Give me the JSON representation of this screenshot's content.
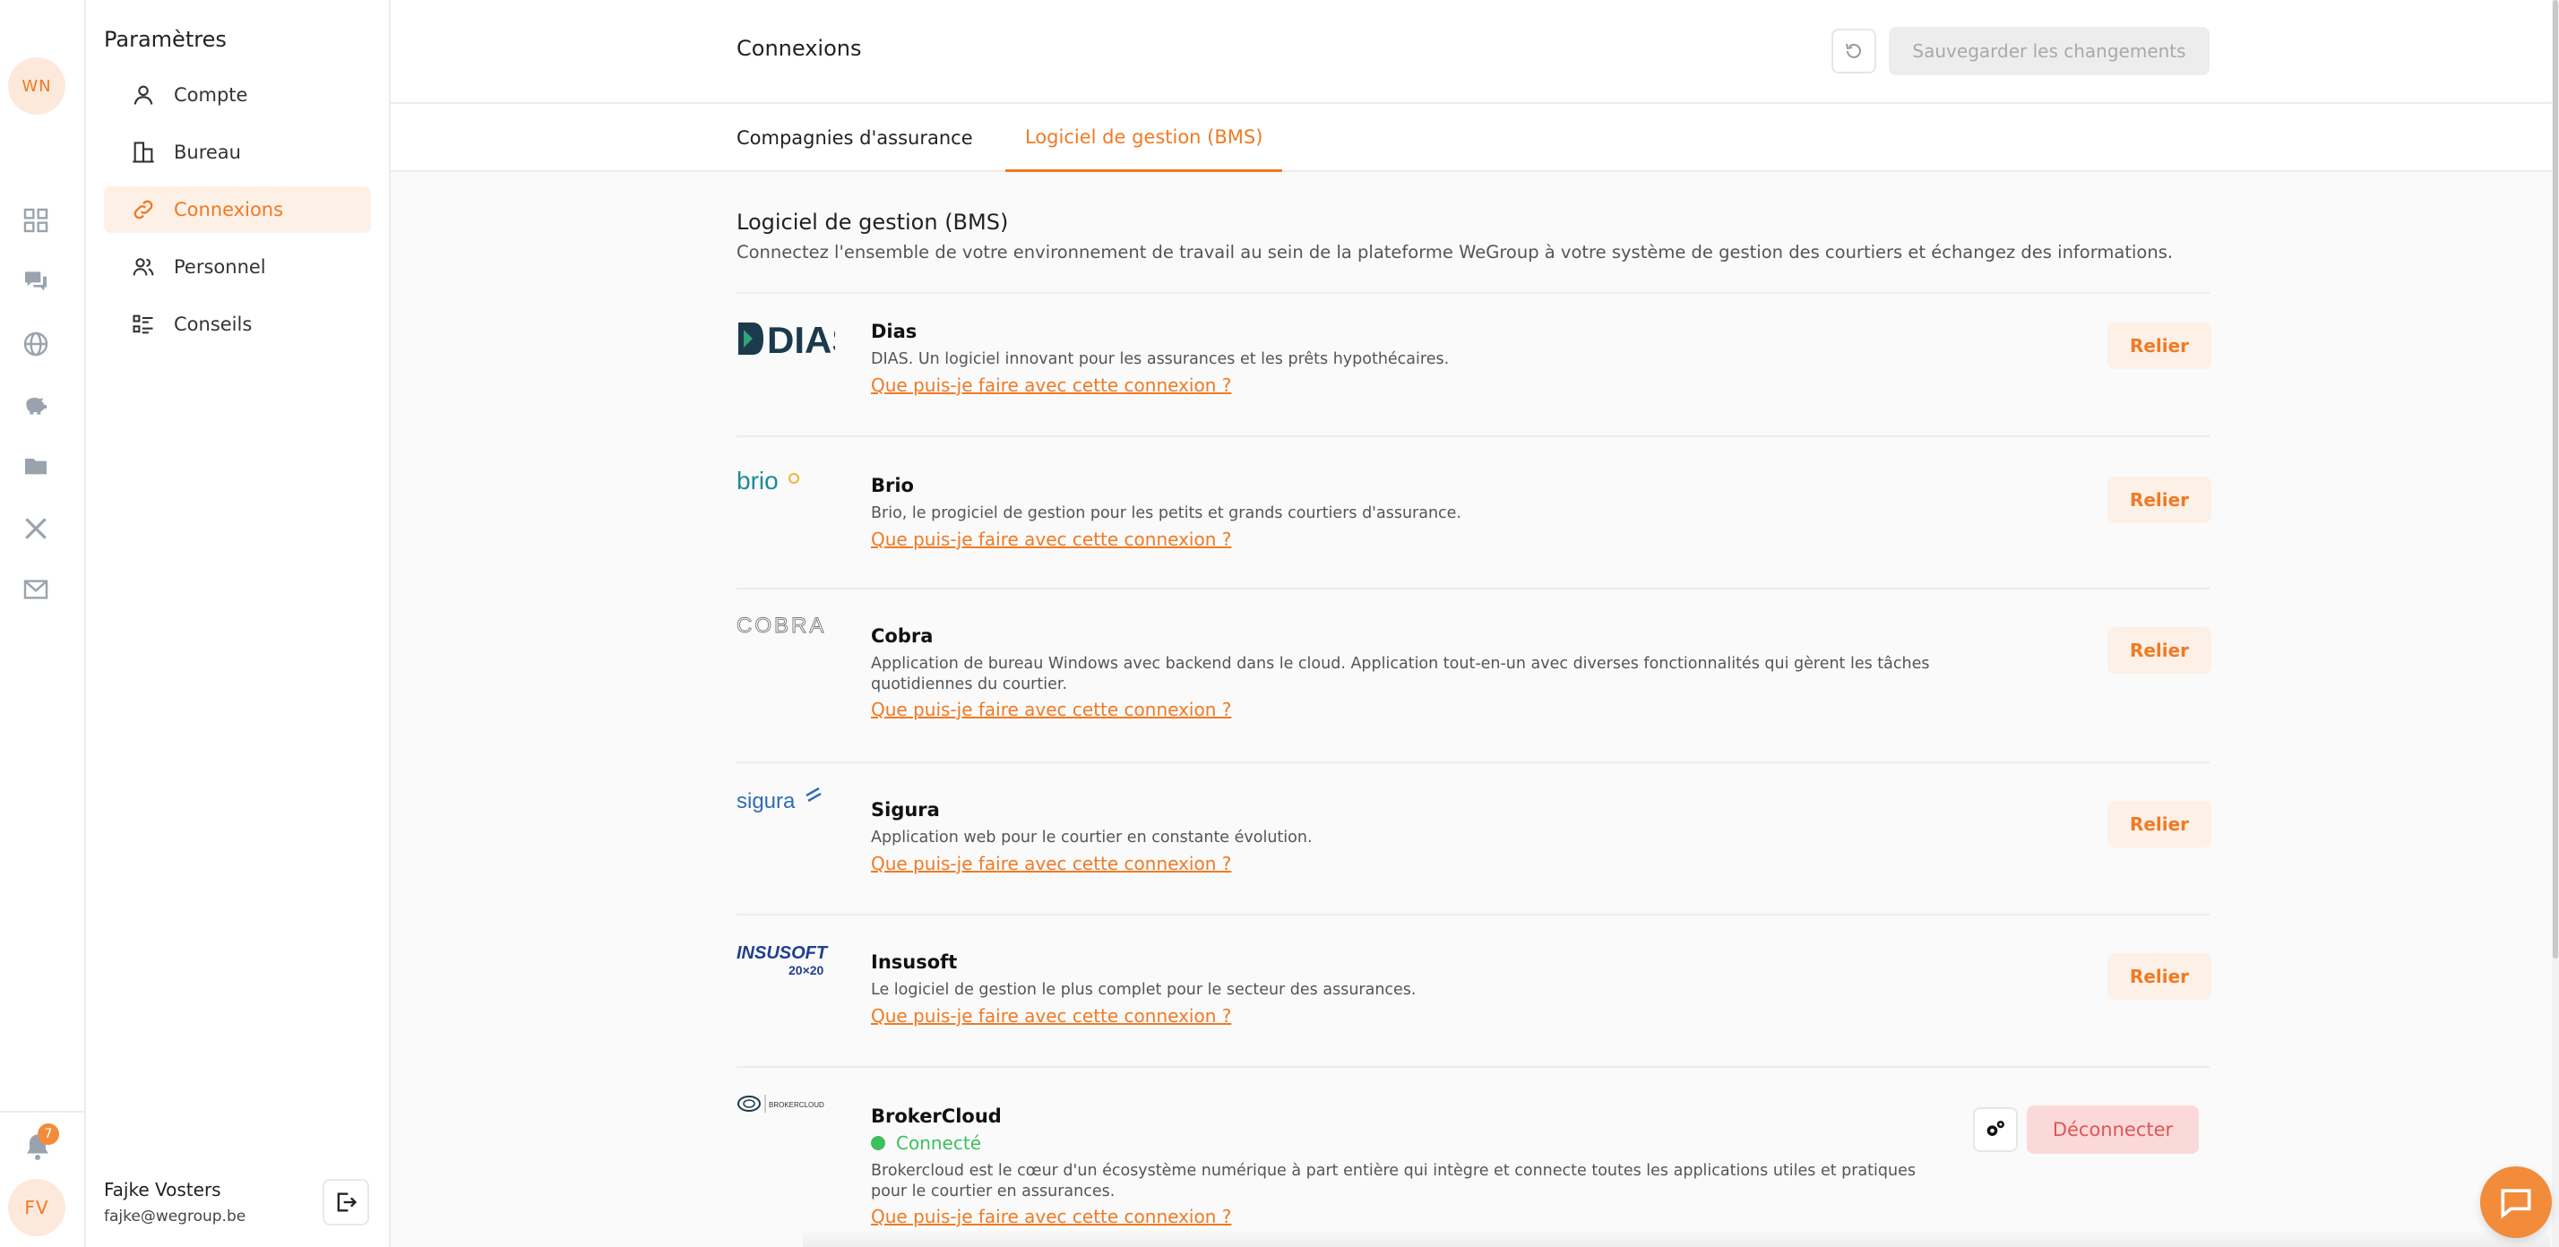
{
  "rail": {
    "user_initials_top": "WN",
    "user_initials_bottom": "FV",
    "notification_count": "7",
    "icons": [
      "grid-icon",
      "chat-icon",
      "globe-icon",
      "piggy-bank-icon",
      "folder-icon",
      "tools-icon",
      "mail-icon"
    ]
  },
  "settings": {
    "title": "Paramètres",
    "items": [
      {
        "label": "Compte",
        "icon": "user-icon"
      },
      {
        "label": "Bureau",
        "icon": "building-icon"
      },
      {
        "label": "Connexions",
        "icon": "link-icon",
        "active": true
      },
      {
        "label": "Personnel",
        "icon": "people-icon"
      },
      {
        "label": "Conseils",
        "icon": "checklist-icon"
      }
    ],
    "user_name": "Fajke Vosters",
    "user_email": "fajke@wegroup.be"
  },
  "header": {
    "title": "Connexions",
    "save_label": "Sauvegarder les changements"
  },
  "tabs": [
    {
      "label": "Compagnies d'assurance"
    },
    {
      "label": "Logiciel de gestion (BMS)",
      "active": true
    }
  ],
  "section": {
    "title": "Logiciel de gestion (BMS)",
    "subtitle": "Connectez l'ensemble de votre environnement de travail au sein de la plateforme WeGroup à votre système de gestion des courtiers et échangez des informations."
  },
  "link_text": "Que puis-je faire avec cette connexion ?",
  "connect_label": "Relier",
  "disconnect_label": "Déconnecter",
  "connected_label": "Connecté",
  "integrations": [
    {
      "name": "Dias",
      "logo_text": "DIAS",
      "description": "DIAS. Un logiciel innovant pour les assurances et les prêts hypothécaires."
    },
    {
      "name": "Brio",
      "logo_text": "brio",
      "description": "Brio, le progiciel de gestion pour les petits et grands courtiers d'assurance."
    },
    {
      "name": "Cobra",
      "logo_text": "COBRA",
      "description": "Application de bureau Windows avec backend dans le cloud. Application tout-en-un avec diverses fonctionnalités qui gèrent les tâches quotidiennes du courtier."
    },
    {
      "name": "Sigura",
      "logo_text": "sigura",
      "description": "Application web pour le courtier en constante évolution."
    },
    {
      "name": "Insusoft",
      "logo_text": "INSUSOFT",
      "logo_subtext": "20×20",
      "description": "Le logiciel de gestion le plus complet pour le secteur des assurances."
    },
    {
      "name": "BrokerCloud",
      "logo_text": "BROKERCLOUD",
      "connected": true,
      "description": "Brokercloud est le cœur d'un écosystème numérique à part entière qui intègre et connecte toutes les applications utiles et pratiques pour le courtier en assurances."
    }
  ],
  "colors": {
    "accent": "#f07a24",
    "accent_light": "#fdf0e6",
    "success": "#3cbf5d",
    "danger": "#e05555"
  }
}
